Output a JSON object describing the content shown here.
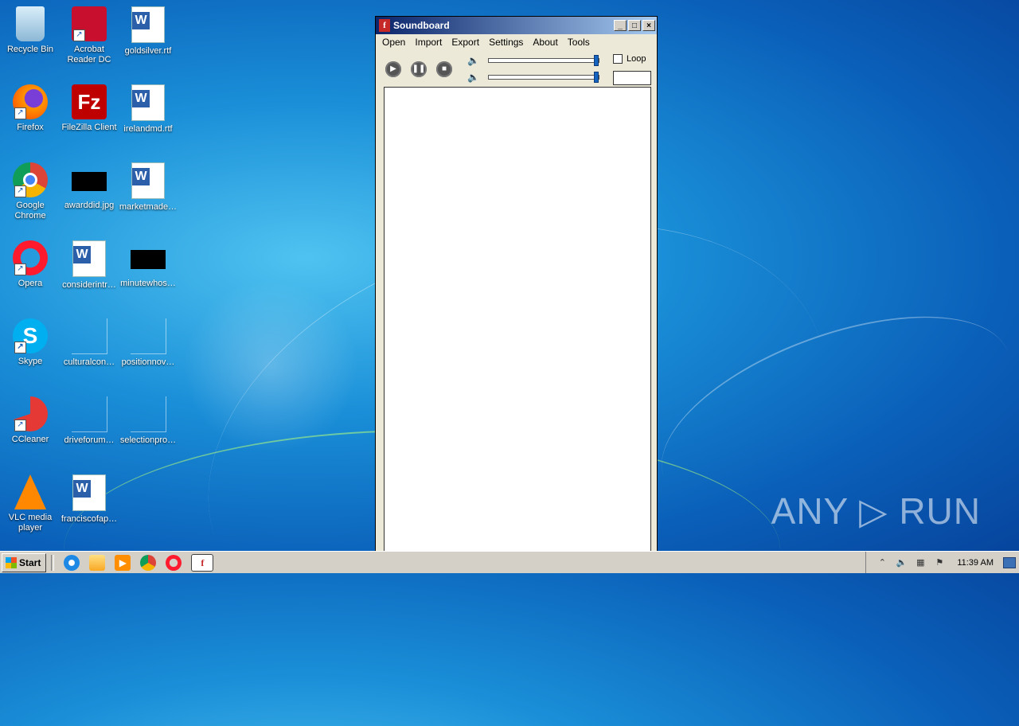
{
  "desktop": {
    "icons": [
      {
        "label": "Recycle Bin",
        "icon": "recycle-bin-icon"
      },
      {
        "label": "Acrobat Reader DC",
        "icon": "acrobat-icon"
      },
      {
        "label": "goldsilver.rtf",
        "icon": "word-document-icon"
      },
      {
        "label": "Firefox",
        "icon": "firefox-icon"
      },
      {
        "label": "FileZilla Client",
        "icon": "filezilla-icon"
      },
      {
        "label": "irelandmd.rtf",
        "icon": "word-document-icon"
      },
      {
        "label": "Google Chrome",
        "icon": "chrome-icon"
      },
      {
        "label": "awarddid.jpg",
        "icon": "image-file-icon"
      },
      {
        "label": "marketmade…",
        "icon": "word-document-icon"
      },
      {
        "label": "Opera",
        "icon": "opera-icon"
      },
      {
        "label": "considerintr…",
        "icon": "word-document-icon"
      },
      {
        "label": "minutewhos…",
        "icon": "image-file-icon"
      },
      {
        "label": "Skype",
        "icon": "skype-icon"
      },
      {
        "label": "culturalcon…",
        "icon": "file-icon"
      },
      {
        "label": "positionnov…",
        "icon": "file-icon"
      },
      {
        "label": "CCleaner",
        "icon": "ccleaner-icon"
      },
      {
        "label": "driveforum…",
        "icon": "file-icon"
      },
      {
        "label": "selectionpro…",
        "icon": "file-icon"
      },
      {
        "label": "VLC media player",
        "icon": "vlc-icon"
      },
      {
        "label": "franciscofap…",
        "icon": "word-document-icon"
      }
    ]
  },
  "window": {
    "title": "Soundboard",
    "menu": [
      "Open",
      "Import",
      "Export",
      "Settings",
      "About",
      "Tools"
    ],
    "loop_label": "Loop",
    "loop_checked": false,
    "volume_1": 1.0,
    "volume_2": 1.0
  },
  "watermark": "ANY ▷ RUN",
  "taskbar": {
    "start_label": "Start",
    "clock": "11:39 AM"
  }
}
